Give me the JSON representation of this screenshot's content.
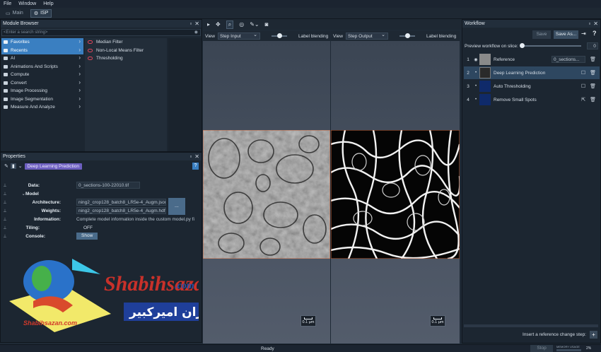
{
  "menu": [
    "File",
    "Window",
    "Help"
  ],
  "modes": [
    {
      "label": "Main",
      "active": false
    },
    {
      "label": "ISP",
      "active": true
    }
  ],
  "module_browser": {
    "title": "Module Browser",
    "search_placeholder": "<Enter a search string>",
    "categories": [
      "Favorites",
      "Recents",
      "AI",
      "Animations And Scripts",
      "Compute",
      "Convert",
      "Image Processing",
      "Image Segmentation",
      "Measure And Analyze"
    ],
    "selected_categories": [
      "Favorites",
      "Recents"
    ],
    "favorites": [
      "Median Filter",
      "Non-Local Means Filter",
      "Thresholding"
    ]
  },
  "properties": {
    "title": "Properties",
    "module_chip": "Deep Learning Prediction",
    "help": "?",
    "rows": {
      "data_label": "Data:",
      "data_value": "0_sections-100-22010.tif",
      "model_label": "Model",
      "architecture_label": "Architecture:",
      "architecture_value": "ning2_crop128_batch8_LR5e-4_Augm.json",
      "weights_label": "Weights:",
      "weights_value": "ning2_crop128_batch8_LR5e-4_Augm.hdf5",
      "information_label": "Information:",
      "information_value": "Complete model information inside the custom model.py fi",
      "tiling_label": "Tiling:",
      "tiling_value": "OFF",
      "console_label": "Console:",
      "console_button": "Show",
      "browse_button": "..."
    }
  },
  "viewers": {
    "view_label": "View",
    "left_select": "Step Input",
    "right_select": "Step Output",
    "label_blending": "Label blending",
    "scale_text": "0.1 µm"
  },
  "workflow": {
    "title": "Workflow",
    "save_label": "Save",
    "save_as_label": "Save As...",
    "preview_label": "Preview workflow on slice:",
    "preview_value": "0",
    "steps": [
      {
        "num": "1",
        "label": "Reference",
        "extra": "0_sections..."
      },
      {
        "num": "2",
        "label": "Deep Learning Prediction"
      },
      {
        "num": "3",
        "label": "Auto Thresholding"
      },
      {
        "num": "4",
        "label": "Remove Small Spots"
      }
    ],
    "insert_label": "Insert a reference change step:"
  },
  "watermark": {
    "brand": "Shabihsazan",
    "brand_suffix": ".com",
    "persian": "شبیه‌سازان امیرکبیر",
    "logo_text": "Shabihsazan.com"
  },
  "status": {
    "text": "Ready",
    "stop_label": "Stop",
    "memory_label": "MEMORY USAGE",
    "memory_value": "2%"
  },
  "colors": {
    "selection_blue": "#3a7fc1",
    "module_chip": "#6d5fc0",
    "workflow_selected": "#2e4760"
  }
}
